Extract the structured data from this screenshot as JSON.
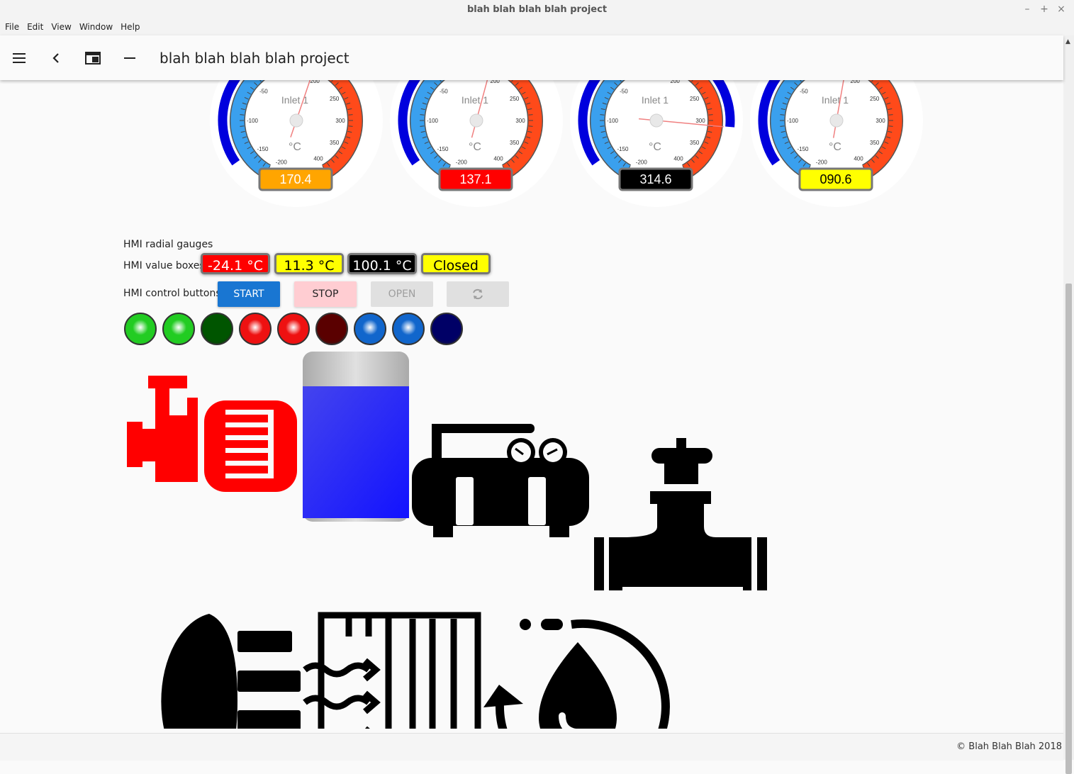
{
  "window": {
    "title": "blah blah blah blah project"
  },
  "menu": [
    "File",
    "Edit",
    "View",
    "Window",
    "Help"
  ],
  "appbar": {
    "title": "blah blah blah blah project"
  },
  "gauges": [
    {
      "label": "Inlet 1",
      "unit": "°C",
      "display": "170.4",
      "display_bg": "#FFA500",
      "display_color": "#ffffff",
      "value": 170.4
    },
    {
      "label": "Inlet 1",
      "unit": "°C",
      "display": "137.1",
      "display_bg": "#FF0000",
      "display_color": "#ffffff",
      "value": 137.1
    },
    {
      "label": "Inlet 1",
      "unit": "°C",
      "display": "314.6",
      "display_bg": "#000000",
      "display_color": "#ffffff",
      "value": 314.6
    },
    {
      "label": "Inlet 1",
      "unit": "°C",
      "display": "090.6",
      "display_bg": "#FFFF00",
      "display_color": "#000000",
      "value": 90.6
    }
  ],
  "gauge_ticks": [
    "0",
    "-50",
    "-100",
    "-150",
    "-200",
    "200",
    "250",
    "300",
    "350",
    "400"
  ],
  "section_labels": {
    "radial": "HMI radial gauges",
    "value_boxes": "HMI value boxes",
    "control_buttons": "HMI control buttons"
  },
  "value_boxes": [
    {
      "text": "-24.1 °C",
      "bg": "#FF0000",
      "color": "#ffffff"
    },
    {
      "text": "11.3 °C",
      "bg": "#FFFF00",
      "color": "#000000"
    },
    {
      "text": "100.1 °C",
      "bg": "#000000",
      "color": "#ffffff"
    },
    {
      "text": "Closed",
      "bg": "#FFFF00",
      "color": "#000000"
    }
  ],
  "buttons": {
    "start": "START",
    "stop": "STOP",
    "open": "OPEN",
    "refresh_icon": "refresh-icon"
  },
  "leds": [
    {
      "state": "on",
      "color": "#22cc22"
    },
    {
      "state": "on",
      "color": "#22cc22"
    },
    {
      "state": "off",
      "color": "#005500"
    },
    {
      "state": "on",
      "color": "#ee1111"
    },
    {
      "state": "on",
      "color": "#ee1111"
    },
    {
      "state": "off",
      "color": "#5a0000"
    },
    {
      "state": "on",
      "color": "#1166cc"
    },
    {
      "state": "on",
      "color": "#1166cc"
    },
    {
      "state": "off",
      "color": "#000066"
    }
  ],
  "tank": {
    "level": 0.8,
    "fill_color": "#1a1aff"
  },
  "symbols": [
    "motor-pump-icon",
    "tank-icon",
    "compressor-icon",
    "gate-valve-icon",
    "fan-icon",
    "heat-exchanger-icon",
    "water-recycle-icon"
  ],
  "footer": {
    "copyright": "© Blah Blah Blah 2018"
  }
}
